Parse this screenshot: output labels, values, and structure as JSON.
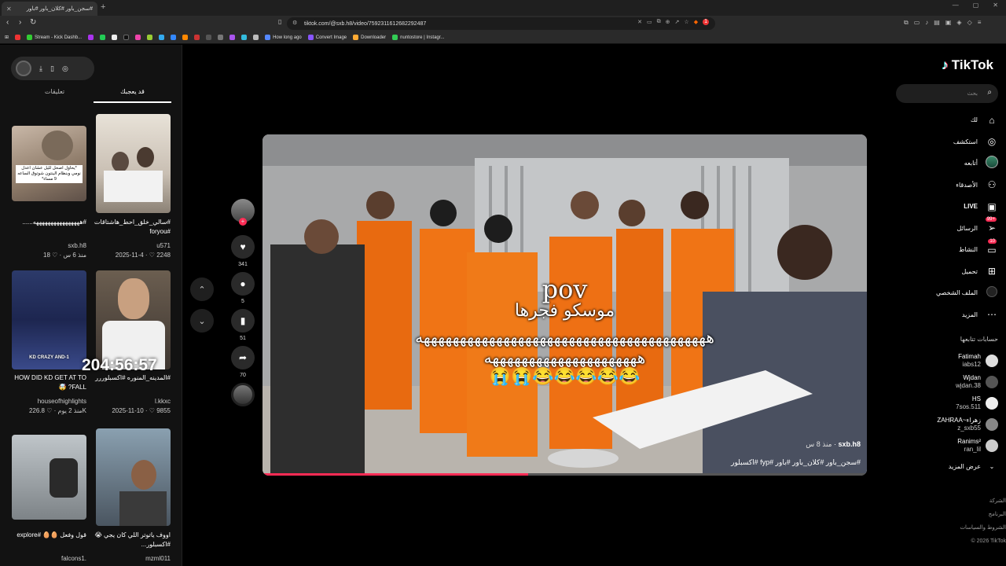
{
  "browser": {
    "tab_title": "#سجن_باور #كلان_باور #باور",
    "url": "tiktok.com/@sxb.h8/video/7592311612682292487",
    "bookmarks": [
      "Stream - Kick Dashb...",
      "How long ago",
      "Convert Image",
      "Downloader",
      "nuntostore | Instagr..."
    ],
    "notification_count": "1"
  },
  "left_panel": {
    "tabs": [
      "تعليقات",
      "قد يعجبك"
    ],
    "active_tab": "قد يعجبك",
    "videos": [
      {
        "overlay_text": "*يحاول اصحل لليل عشان اعدل نومي وبنظام الينتون شوتوق الساعه 9 مساء*",
        "caption": "#ههههههههههههههههه......",
        "author": "sxb.h8",
        "likes": "18",
        "date": "منذ 6 س"
      },
      {
        "overlay_text": "",
        "caption": "#سالي_خلق_احط_هاشتاقات #foryou",
        "author": "u571",
        "likes": "2248",
        "date": "2025-11-4"
      },
      {
        "overlay_text": "KD CRAZY AND-1",
        "caption": "HOW DID KD GET AT TO FALL? 🤯",
        "author": "houseofhighlights",
        "likes": "226.8K",
        "date": "منذ 2 يوم"
      },
      {
        "overlay_text": "204:56:57",
        "caption": "#المدينه_المنوره #اكسبلوررر",
        "author": "l.kkxc",
        "likes": "9855",
        "date": "2025-11-10"
      },
      {
        "overlay_text": "",
        "caption": "قول وفعل 🥚🥚 #explore",
        "author": "falcons1.",
        "likes": "",
        "date": ""
      },
      {
        "overlay_text": "",
        "caption": "اووف ياتوتر اللي كان يجي 😭 #اكسبلور...",
        "author": "mzml011",
        "likes": "",
        "date": ""
      }
    ],
    "timer_overlay": "204:56:57"
  },
  "video": {
    "overlay_title": "pov",
    "overlay_line1": "موسكو فجرها",
    "overlay_line2": "ههههههههههههههههههههههههههههههههههههههههه",
    "overlay_line3": "هههههههههههههههههههههه",
    "overlay_emojis": "😭😭😂😂😂😂😂",
    "author": "sxb.h8",
    "time_ago": "منذ 8 س",
    "caption": "#سجن_باور #كلان_باور #باور #fyp #اكسبلور",
    "progress_fraction": 0.44
  },
  "actions": {
    "likes": "341",
    "comments": "5",
    "saves": "51",
    "shares": "70"
  },
  "sidebar": {
    "logo": "TikTok",
    "search_placeholder": "بحث",
    "nav": [
      {
        "label": "لك",
        "icon": "home-icon"
      },
      {
        "label": "استكشف",
        "icon": "compass-icon"
      },
      {
        "label": "أتابعه",
        "icon": "following-icon"
      },
      {
        "label": "الأصدقاء",
        "icon": "friends-icon"
      },
      {
        "label": "LIVE",
        "icon": "live-icon"
      },
      {
        "label": "الرسائل",
        "icon": "messages-icon",
        "badge": "99+"
      },
      {
        "label": "النشاط",
        "icon": "activity-icon",
        "badge": "10"
      },
      {
        "label": "تحميل",
        "icon": "upload-icon"
      },
      {
        "label": "الملف الشخصي",
        "icon": "profile-icon"
      },
      {
        "label": "المزيد",
        "icon": "more-icon"
      }
    ],
    "following_title": "حسابات تتابعها",
    "accounts": [
      {
        "name": "Fatimah",
        "handle": "iabs12"
      },
      {
        "name": "Wjdan",
        "handle": "wjdan.38"
      },
      {
        "name": "HS",
        "handle": "7sos.511"
      },
      {
        "name": "ZAHRAA~زهراء",
        "handle": "z_sxb55"
      },
      {
        "name": "Ranim⁠s²",
        "handle": "ran_lil"
      }
    ],
    "see_more": "عرض المزيد",
    "footer": [
      "الشركة",
      "البرنامج",
      "الشروط والسياسات",
      "© 2026 TikTok"
    ]
  }
}
